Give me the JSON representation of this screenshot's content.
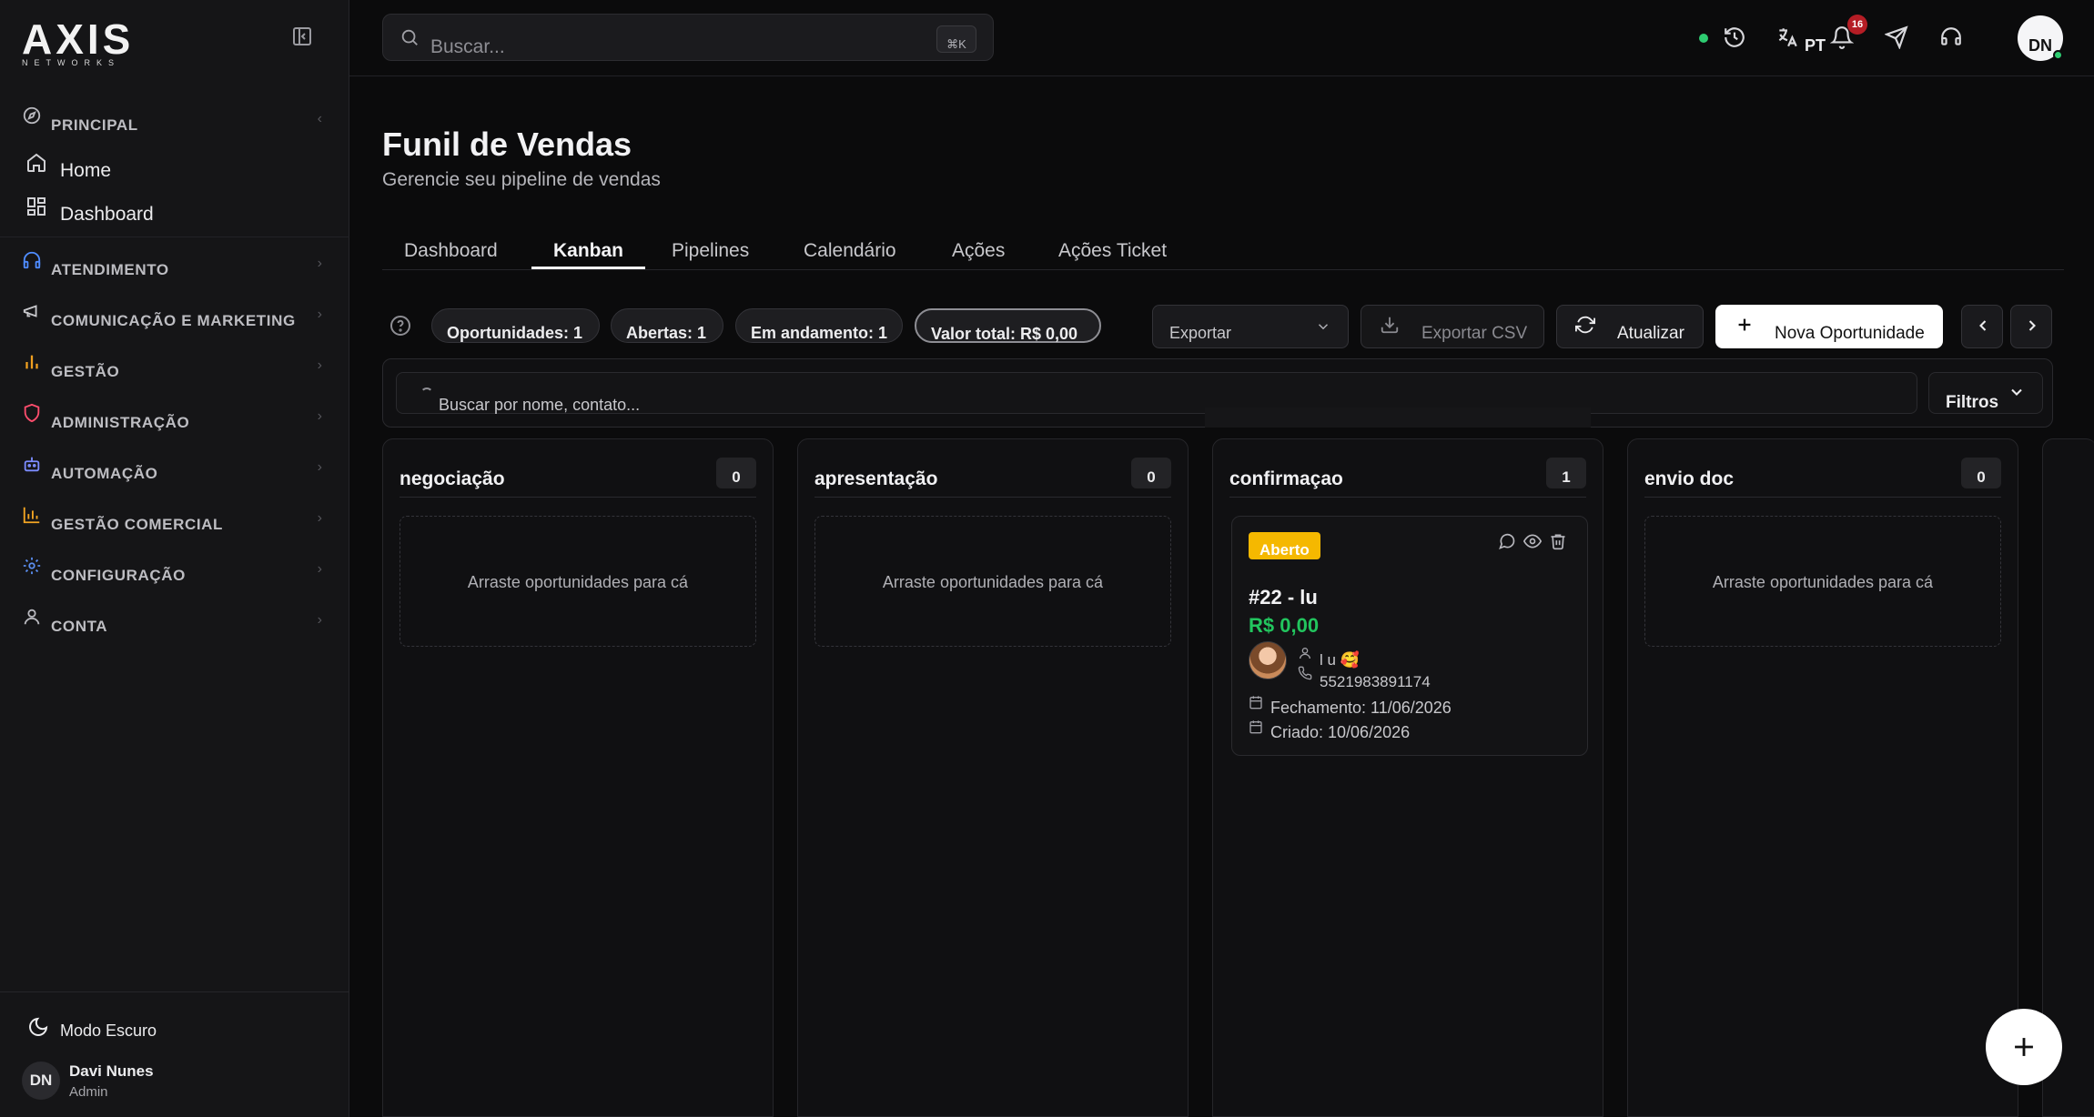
{
  "brand": {
    "name": "AXIS",
    "sub": "NETWORKS"
  },
  "sidebar": {
    "sections": [
      {
        "label": "PRINCIPAL",
        "icon": "compass-icon",
        "items": [
          {
            "label": "Home",
            "icon": "home-icon"
          },
          {
            "label": "Dashboard",
            "icon": "grid-icon"
          }
        ]
      },
      {
        "label": "ATENDIMENTO",
        "icon": "headphones-icon",
        "color": "#4f8cff"
      },
      {
        "label": "COMUNICAÇÃO E MARKETING",
        "icon": "megaphone-icon"
      },
      {
        "label": "GESTÃO",
        "icon": "bar-chart-icon",
        "color": "#f0a020"
      },
      {
        "label": "ADMINISTRAÇÃO",
        "icon": "shield-icon",
        "color": "#ff4d6d"
      },
      {
        "label": "AUTOMAÇÃO",
        "icon": "bot-icon",
        "color": "#7c8cff"
      },
      {
        "label": "GESTÃO COMERCIAL",
        "icon": "chart-icon",
        "color": "#f5a623"
      },
      {
        "label": "CONFIGURAÇÃO",
        "icon": "gear-icon",
        "color": "#5a8dee"
      },
      {
        "label": "CONTA",
        "icon": "user-icon"
      }
    ],
    "dark_mode_label": "Modo Escuro",
    "user": {
      "initials": "DN",
      "name": "Davi Nunes",
      "role": "Admin"
    }
  },
  "topbar": {
    "search_placeholder": "Buscar...",
    "shortcut": "⌘K",
    "language": "PT",
    "notifications": "16",
    "avatar_initials": "DN"
  },
  "header": {
    "title": "Funil de Vendas",
    "subtitle": "Gerencie seu pipeline de vendas"
  },
  "tabs": [
    "Dashboard",
    "Kanban",
    "Pipelines",
    "Calendário",
    "Ações",
    "Ações Ticket"
  ],
  "active_tab": "Kanban",
  "stats": {
    "opportunities": "Oportunidades: 1",
    "open": "Abertas: 1",
    "in_progress": "Em andamento: 1",
    "total_value": "Valor total: R$ 0,00"
  },
  "toolbar": {
    "export_select": "Exportar",
    "export_csv": "Exportar CSV",
    "refresh": "Atualizar",
    "new_opportunity": "Nova Oportunidade"
  },
  "filter": {
    "placeholder": "Buscar por nome, contato...",
    "filters_label": "Filtros"
  },
  "columns": [
    {
      "name": "negociação",
      "count": "0",
      "empty_text": "Arraste oportunidades para cá"
    },
    {
      "name": "apresentação",
      "count": "0",
      "empty_text": "Arraste oportunidades para cá"
    },
    {
      "name": "confirmaçao",
      "count": "1",
      "card": {
        "status": "Aberto",
        "title": "#22 - lu",
        "value": "R$ 0,00",
        "contact_name": "l u 🥰",
        "phone": "5521983891174",
        "closing": "Fechamento: 11/06/2026",
        "created": "Criado: 10/06/2026"
      }
    },
    {
      "name": "envio doc",
      "count": "0",
      "empty_text": "Arraste oportunidades para cá"
    }
  ]
}
